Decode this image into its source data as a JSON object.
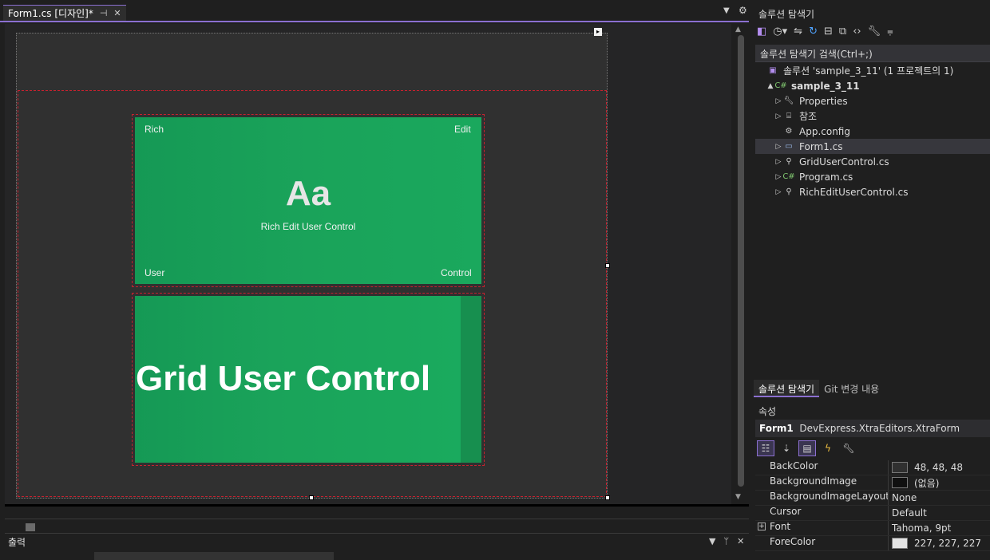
{
  "document_tab": {
    "title": "Form1.cs [디자인]*",
    "pin_icon": "pin-icon",
    "close_icon": "close-icon"
  },
  "designer": {
    "richedit": {
      "top_left": "Rich",
      "top_right": "Edit",
      "center_big": "Aa",
      "center_caption": "Rich Edit User Control",
      "bottom_left": "User",
      "bottom_right": "Control"
    },
    "grid": {
      "label": "Grid User Control"
    }
  },
  "output_panel": {
    "title": "출력"
  },
  "solution_explorer": {
    "title": "솔루션 탐색기",
    "search_placeholder": "솔루션 탐색기 검색(Ctrl+;)",
    "tree": [
      {
        "label": "솔루션 'sample_3_11' (1 프로젝트의 1)",
        "icon": "solution-icon",
        "level": 0,
        "expander": ""
      },
      {
        "label": "sample_3_11",
        "icon": "csharp-project-icon",
        "level": 1,
        "expander": "▲",
        "bold": true
      },
      {
        "label": "Properties",
        "icon": "wrench-icon",
        "level": 2,
        "expander": "▷"
      },
      {
        "label": "참조",
        "icon": "references-icon",
        "level": 2,
        "expander": "▷"
      },
      {
        "label": "App.config",
        "icon": "config-icon",
        "level": 2,
        "expander": ""
      },
      {
        "label": "Form1.cs",
        "icon": "form-icon",
        "level": 2,
        "expander": "▷",
        "selected": true
      },
      {
        "label": "GridUserControl.cs",
        "icon": "usercontrol-icon",
        "level": 2,
        "expander": "▷"
      },
      {
        "label": "Program.cs",
        "icon": "csharp-file-icon",
        "level": 2,
        "expander": "▷"
      },
      {
        "label": "RichEditUserControl.cs",
        "icon": "usercontrol-icon",
        "level": 2,
        "expander": "▷"
      }
    ],
    "tabs": [
      "솔루션 탐색기",
      "Git 변경 내용"
    ]
  },
  "properties": {
    "title": "속성",
    "object_name": "Form1",
    "object_type": "DevExpress.XtraEditors.XtraForm",
    "rows": [
      {
        "name": "BackColor",
        "value": "48, 48, 48",
        "swatch": "#303030"
      },
      {
        "name": "BackgroundImage",
        "value": "(없음)",
        "swatch": "#101010"
      },
      {
        "name": "BackgroundImageLayout",
        "value": "None"
      },
      {
        "name": "Cursor",
        "value": "Default"
      },
      {
        "name": "Font",
        "value": "Tahoma, 9pt",
        "expandable": true
      },
      {
        "name": "ForeColor",
        "value": "227, 227, 227",
        "swatch": "#e3e3e3"
      }
    ]
  },
  "colors": {
    "accent": "#8b6fd0",
    "control_green": "#1aa35a",
    "selection_dash": "#c8212f"
  }
}
